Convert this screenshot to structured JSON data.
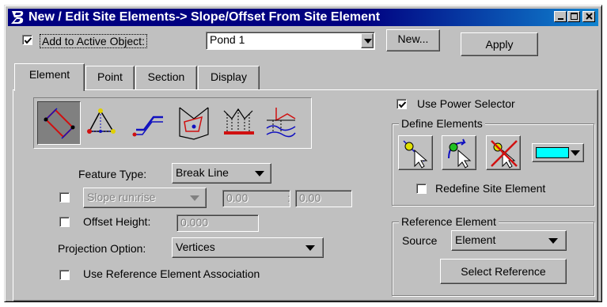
{
  "window": {
    "title": "New / Edit Site Elements-> Slope/Offset From Site Element",
    "app_icon": "bentley-b-icon",
    "controls": [
      "minimize-icon",
      "maximize-icon",
      "close-icon"
    ]
  },
  "active_object": {
    "checked": true,
    "label": "Add to Active Object:",
    "value": "Pond 1",
    "new_label": "New...",
    "apply_label": "Apply"
  },
  "tabs": [
    {
      "label": "Element",
      "active": true
    },
    {
      "label": "Point",
      "active": false
    },
    {
      "label": "Section",
      "active": false
    },
    {
      "label": "Display",
      "active": false
    }
  ],
  "element_tools": [
    {
      "icon": "slope-rectangle-icon",
      "selected": true
    },
    {
      "icon": "triangle-points-icon",
      "selected": false
    },
    {
      "icon": "offset-line-icon",
      "selected": false
    },
    {
      "icon": "profile-section-icon",
      "selected": false
    },
    {
      "icon": "vertical-drop-icon",
      "selected": false
    },
    {
      "icon": "surface-projection-icon",
      "selected": false
    }
  ],
  "feature_type": {
    "label": "Feature Type:",
    "value": "Break Line"
  },
  "slope": {
    "checked": false,
    "value": "Slope run:rise",
    "run": "0.00",
    "separator": ":",
    "rise": "0.00"
  },
  "offset_height": {
    "checked": false,
    "label": "Offset Height:",
    "value": "0.000"
  },
  "projection": {
    "label": "Projection Option:",
    "value": "Vertices"
  },
  "reference_association": {
    "checked": false,
    "label": "Use Reference Element Association"
  },
  "power_selector": {
    "checked": true,
    "label": "Use Power Selector"
  },
  "define_elements": {
    "title": "Define Elements",
    "buttons": [
      "select-element-icon",
      "rotate-select-icon",
      "deselect-element-icon"
    ],
    "color": "#00ffff",
    "redefine": {
      "checked": false,
      "label": "Redefine Site Element"
    }
  },
  "reference_element": {
    "title": "Reference Element",
    "source_label": "Source",
    "source_value": "Element",
    "select_label": "Select Reference"
  }
}
